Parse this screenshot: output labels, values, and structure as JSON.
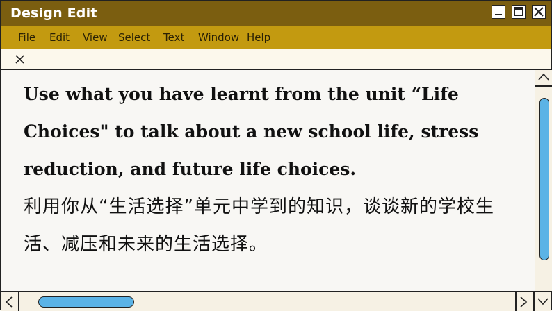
{
  "window": {
    "title": "Design Edit",
    "colors": {
      "titlebar": "#7b5e10",
      "menubar": "#c39a10",
      "scroll_thumb": "#5bb3e6"
    }
  },
  "menu": [
    "File",
    "Edit",
    "View",
    "Select",
    "Text",
    "Window",
    "Help"
  ],
  "tab": {
    "close_icon": "close-icon"
  },
  "content": {
    "english": "Use what you have learnt from the unit “Life Choices\" to talk about a new school life, stress reduction, and future life choices.",
    "chinese": "利用你从“生活选择”单元中学到的知识，谈谈新的学校生活、减压和未来的生活选择。"
  }
}
